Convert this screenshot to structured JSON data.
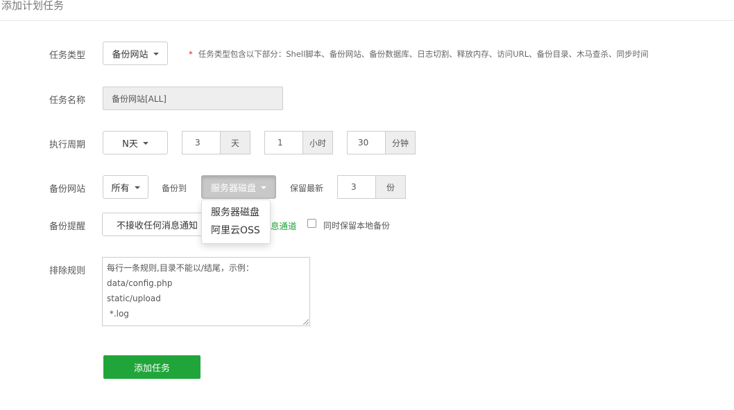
{
  "page": {
    "title": "添加计划任务"
  },
  "task_type": {
    "label": "任务类型",
    "selected": "备份网站",
    "hint_star": "*",
    "hint": "任务类型包含以下部分：Shell脚本、备份网站、备份数据库、日志切割、释放内存、访问URL、备份目录、木马查杀、同步时间"
  },
  "task_name": {
    "label": "任务名称",
    "value": "备份网站[ALL]"
  },
  "period": {
    "label": "执行周期",
    "type_selected": "N天",
    "days_value": "3",
    "days_unit": "天",
    "hours_value": "1",
    "hours_unit": "小时",
    "minutes_value": "30",
    "minutes_unit": "分钟"
  },
  "backup_site": {
    "label": "备份网站",
    "site_selected": "所有",
    "to_label": "备份到",
    "to_selected": "服务器磁盘",
    "keep_label": "保留最新",
    "keep_value": "3",
    "keep_unit": "份"
  },
  "backup_dropdown": {
    "items": [
      "服务器磁盘",
      "阿里云OSS"
    ]
  },
  "notify": {
    "label": "备份提醒",
    "selected": "不接收任何消息通知",
    "link": "息通道",
    "keep_local_label": "同时保留本地备份",
    "keep_local_checked": false
  },
  "exclude": {
    "label": "排除规则",
    "placeholder": "每行一条规则,目录不能以/结尾，示例：\ndata/config.php\nstatic/upload\n *.log"
  },
  "submit": {
    "label": "添加任务"
  },
  "colors": {
    "accent": "#20a53a",
    "required_star": "#e02020"
  }
}
